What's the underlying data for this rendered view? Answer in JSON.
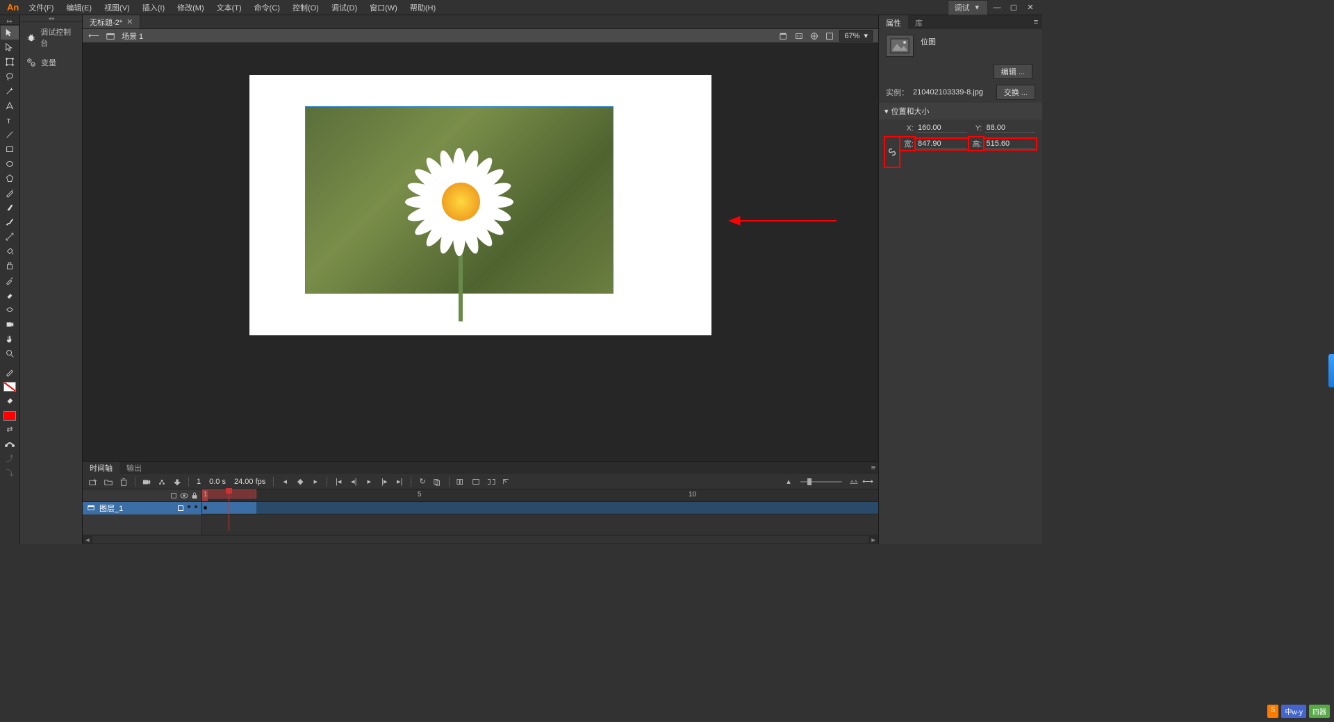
{
  "app": {
    "logo": "An"
  },
  "menu": {
    "items": [
      "文件(F)",
      "编辑(E)",
      "视图(V)",
      "插入(I)",
      "修改(M)",
      "文本(T)",
      "命令(C)",
      "控制(O)",
      "调试(D)",
      "窗口(W)",
      "帮助(H)"
    ],
    "workspace": "调试"
  },
  "left_panel": {
    "debug_console": "调试控制台",
    "variables": "变量"
  },
  "document": {
    "tab_title": "无标题-2*"
  },
  "scene": {
    "name": "场景 1",
    "zoom": "67%"
  },
  "timeline": {
    "tabs": [
      "时间轴",
      "输出"
    ],
    "frame": "1",
    "time": "0.0 s",
    "fps": "24.00 fps",
    "ruler_marks": [
      "1",
      "5",
      "10"
    ],
    "layer": "图层_1"
  },
  "properties": {
    "tabs": [
      "属性",
      "库"
    ],
    "type": "位图",
    "edit_btn": "编辑 ...",
    "instance_label": "实例：",
    "instance_name": "210402103339-8.jpg",
    "swap_btn": "交换 ...",
    "section": "位置和大小",
    "x_label": "X:",
    "x_value": "160.00",
    "y_label": "Y:",
    "y_value": "88.00",
    "w_label": "宽:",
    "w_value": "847.90",
    "h_label": "高:",
    "h_value": "515.60"
  },
  "watermark": {
    "a": "S",
    "b": "中w·y",
    "c": "四器"
  }
}
